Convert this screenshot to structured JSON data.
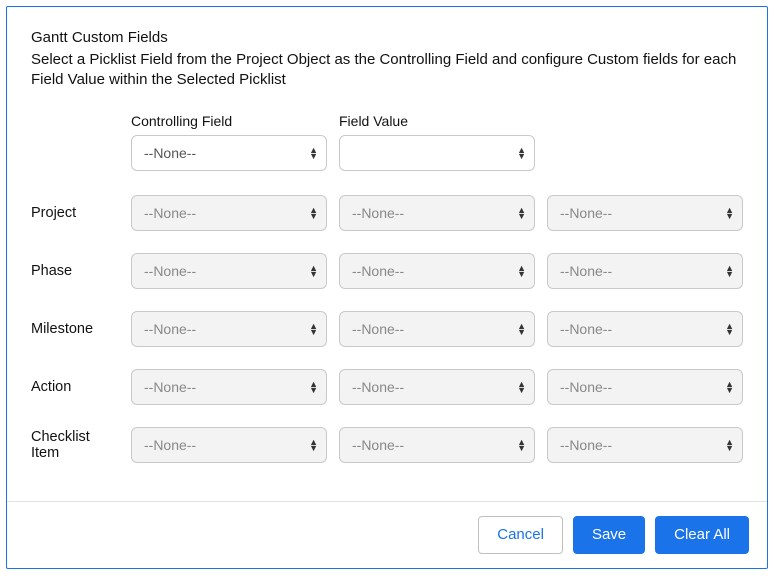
{
  "header": {
    "title": "Gantt Custom Fields",
    "description": "Select a Picklist Field from the Project Object as the Controlling Field and configure Custom fields for each Field Value within the Selected Picklist"
  },
  "topRow": {
    "controllingField": {
      "label": "Controlling Field",
      "value": "--None--"
    },
    "fieldValue": {
      "label": "Field Value",
      "value": ""
    }
  },
  "rows": [
    {
      "label": "Project",
      "fields": [
        "--None--",
        "--None--",
        "--None--"
      ]
    },
    {
      "label": "Phase",
      "fields": [
        "--None--",
        "--None--",
        "--None--"
      ]
    },
    {
      "label": "Milestone",
      "fields": [
        "--None--",
        "--None--",
        "--None--"
      ]
    },
    {
      "label": "Action",
      "fields": [
        "--None--",
        "--None--",
        "--None--"
      ]
    },
    {
      "label": "Checklist Item",
      "fields": [
        "--None--",
        "--None--",
        "--None--"
      ]
    }
  ],
  "footer": {
    "cancel": "Cancel",
    "save": "Save",
    "clearAll": "Clear All"
  }
}
